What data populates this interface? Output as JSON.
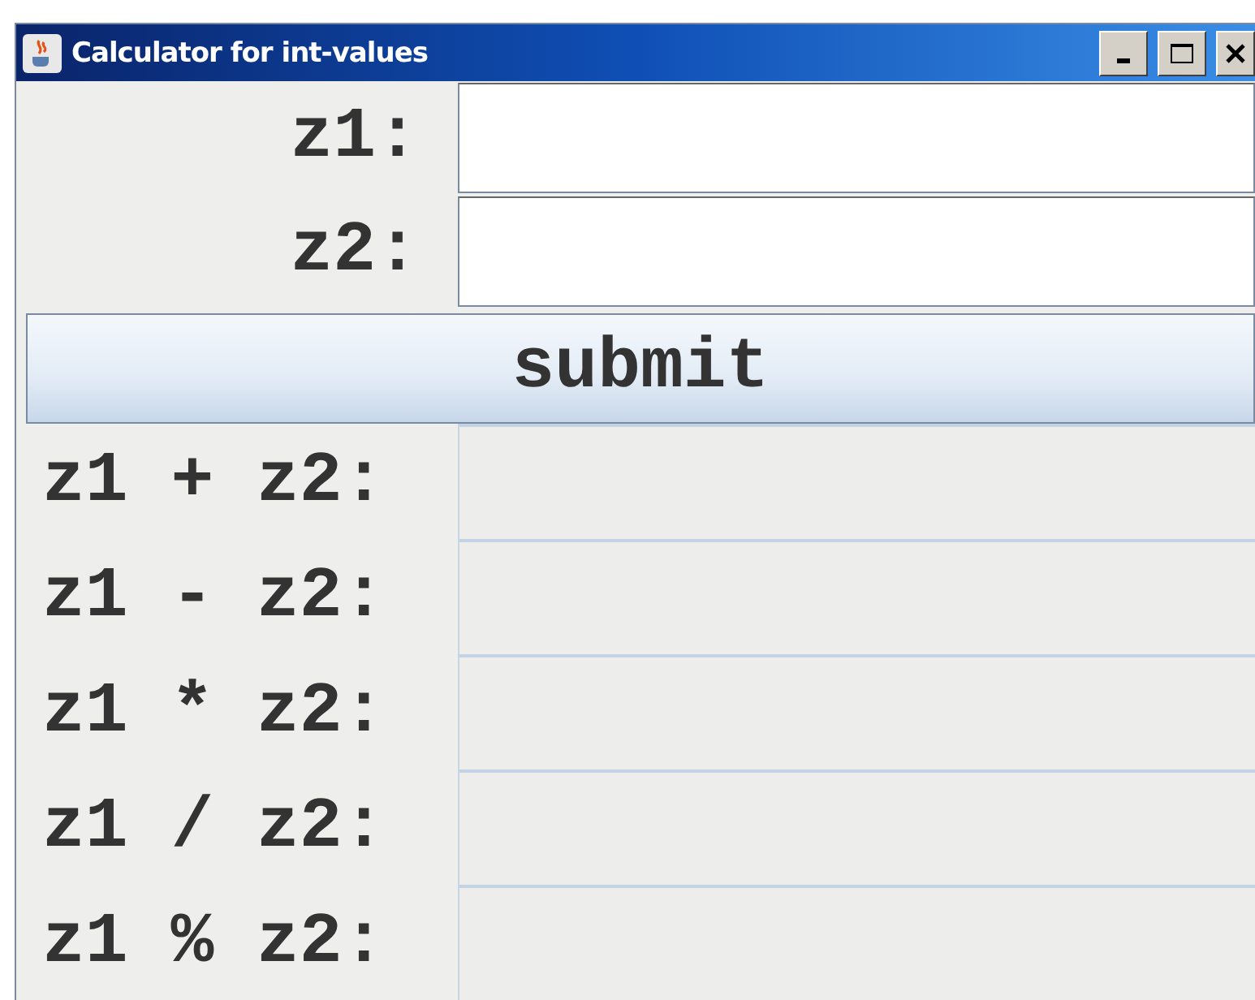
{
  "window": {
    "title": "Calculator for int-values"
  },
  "inputs": [
    {
      "label": "z1:"
    },
    {
      "label": "z2:"
    }
  ],
  "submit": {
    "label": "submit"
  },
  "results": [
    {
      "label": "z1 + z2:"
    },
    {
      "label": "z1 - z2:"
    },
    {
      "label": "z1 * z2:"
    },
    {
      "label": "z1 / z2:"
    },
    {
      "label": "z1 % z2:"
    }
  ]
}
